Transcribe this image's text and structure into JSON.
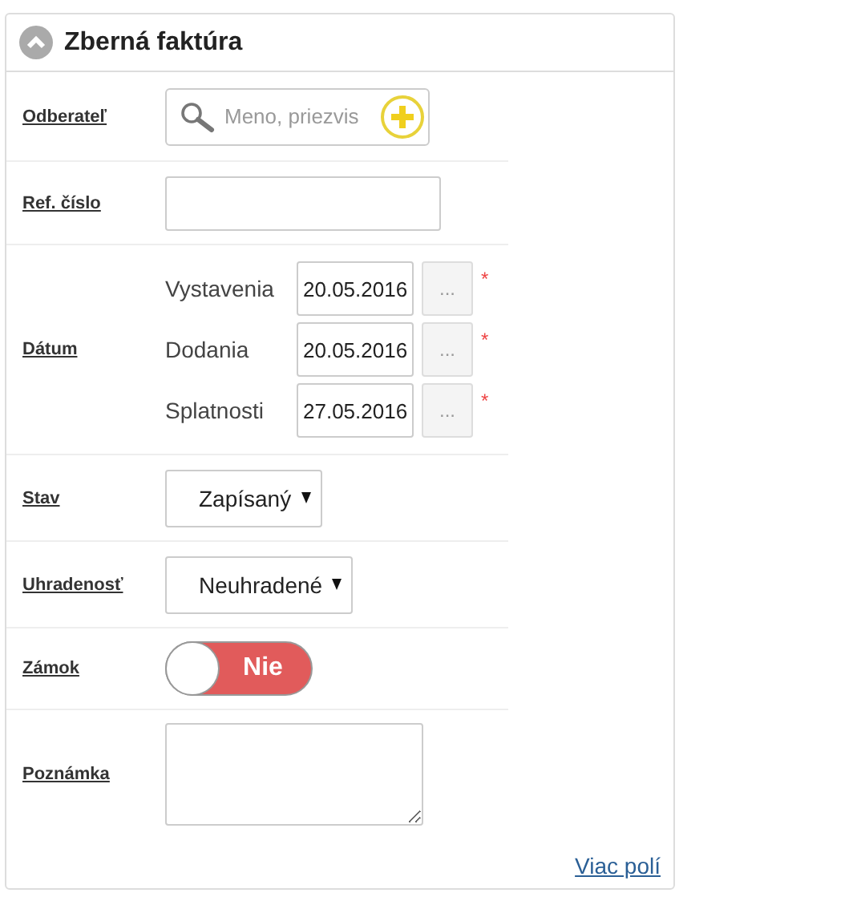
{
  "panel": {
    "title": "Zberná faktúra",
    "expanded": true
  },
  "fields": [
    {
      "kind": "search",
      "label": "Odberateľ",
      "placeholder": "Meno, priezvis"
    },
    {
      "kind": "text",
      "label": "Ref. číslo"
    },
    {
      "kind": "dates",
      "label": "Dátum",
      "dates": [
        {
          "label": "Vystavenia",
          "value": "20.05.2016",
          "button": "...",
          "required_mark": "*"
        },
        {
          "label": "Dodania",
          "value": "20.05.2016",
          "button": "...",
          "required_mark": "*"
        },
        {
          "label": "Splatnosti",
          "value": "27.05.2016",
          "button": "...",
          "required_mark": "*"
        }
      ]
    },
    {
      "kind": "select",
      "label": "Stav",
      "value": "Zapísaný"
    },
    {
      "kind": "select",
      "label": "Uhradenosť",
      "value": "Neuhradené"
    },
    {
      "kind": "toggle",
      "label": "Zámok",
      "on": false,
      "text": "Nie"
    },
    {
      "kind": "textarea",
      "label": "Poznámka"
    }
  ],
  "more_link": "Viac polí"
}
